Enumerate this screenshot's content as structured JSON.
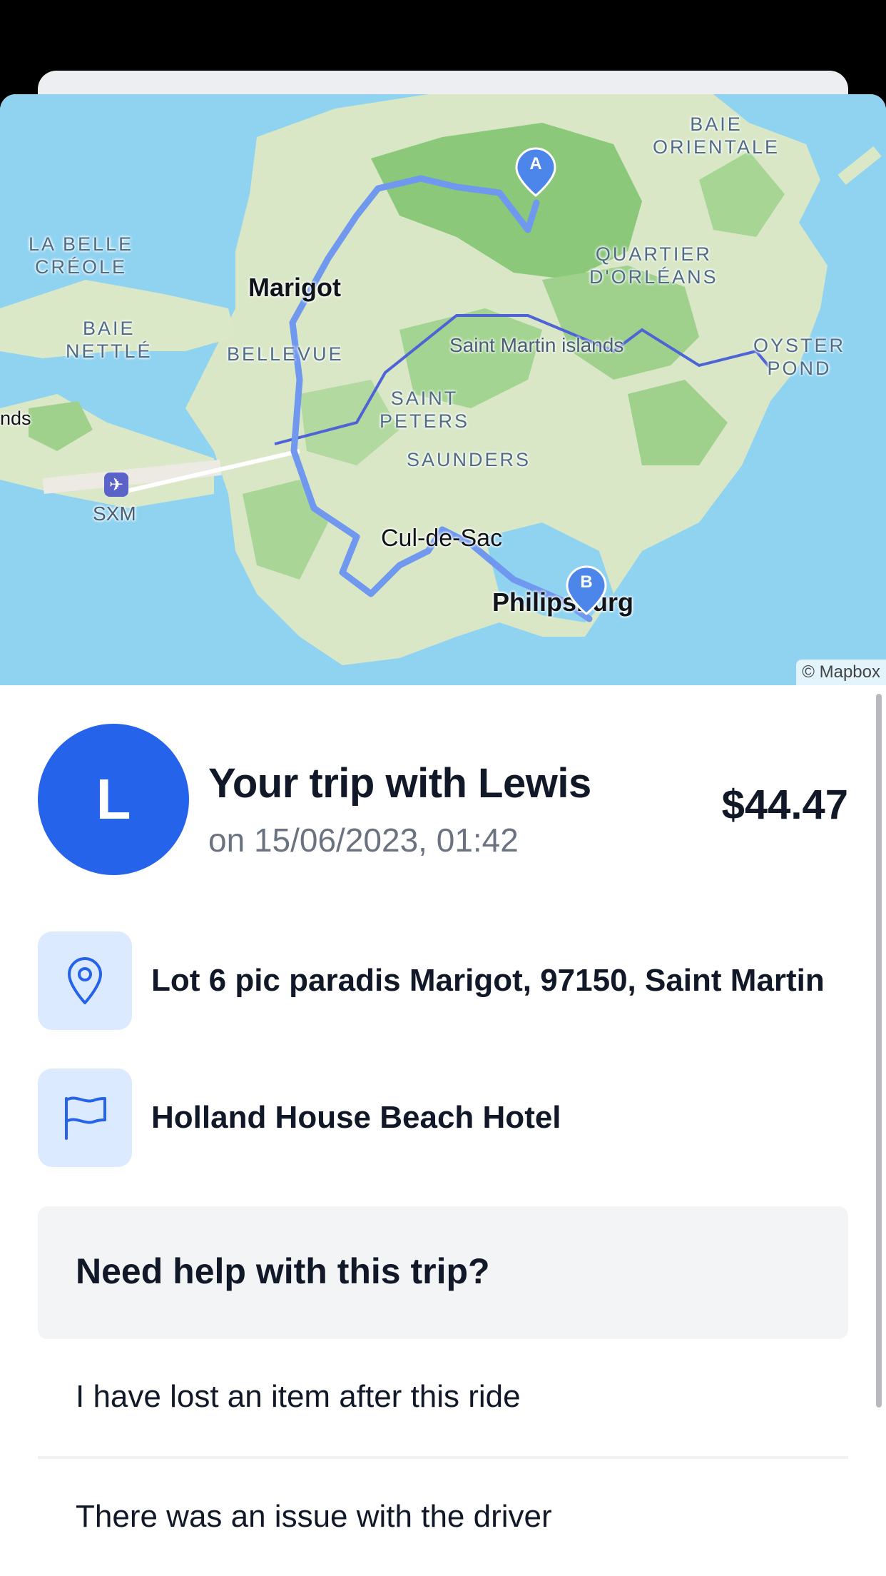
{
  "map": {
    "labels": {
      "baie_orientale": "BAIE\nORIENTALE",
      "la_belle_creole": "LA BELLE\nCRÉOLE",
      "marigot": "Marigot",
      "quartier_dorleans": "QUARTIER\nD'ORLÉANS",
      "baie_nettle": "BAIE\nNETTLÉ",
      "bellevue": "BELLEVUE",
      "saint_martin_islands": "Saint Martin islands",
      "oyster_pond": "OYSTER\nPOND",
      "nds": "nds",
      "saint_peters": "SAINT\nPETERS",
      "saunders": "SAUNDERS",
      "sxm": "SXM",
      "cul_de_sac": "Cul-de-Sac",
      "philipsburg": "Philipsburg"
    },
    "pin_a": "A",
    "pin_b": "B",
    "attribution": "© Mapbox"
  },
  "trip": {
    "avatar_initial": "L",
    "title": "Your trip with Lewis",
    "date": "on 15/06/2023, 01:42",
    "price": "$44.47"
  },
  "stops": {
    "pickup": "Lot 6 pic paradis Marigot, 97150, Saint Martin",
    "dropoff": "Holland House Beach Hotel"
  },
  "help": {
    "title": "Need help with this trip?",
    "items": [
      "I have lost an item after this ride",
      "There was an issue with the driver"
    ]
  },
  "colors": {
    "accent": "#2563eb",
    "route": "#6f98ee",
    "icon_bg": "#dbeafe"
  },
  "icons": [
    "location-pin-icon",
    "flag-icon",
    "airport-icon"
  ]
}
